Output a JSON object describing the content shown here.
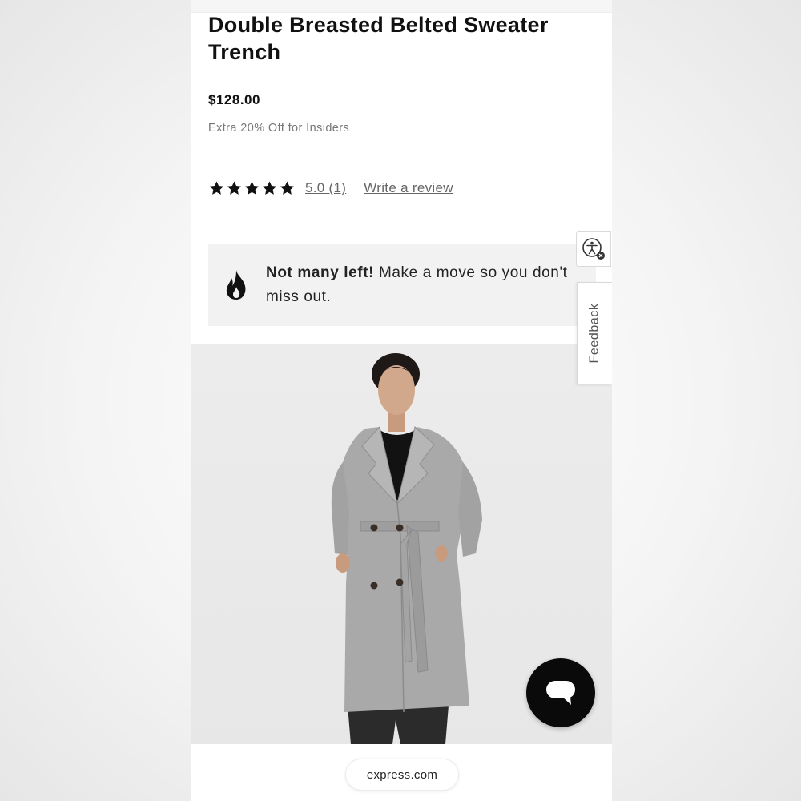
{
  "product": {
    "title": "Double Breasted Belted Sweater Trench",
    "price": "$128.00",
    "promo": "Extra 20% Off for Insiders"
  },
  "rating": {
    "stars": 5,
    "score_link": "5.0 (1)",
    "write_review": "Write a review"
  },
  "scarcity": {
    "icon": "fire-icon",
    "headline": "Not many left!",
    "body": " Make a move so you don't miss out."
  },
  "side_widgets": {
    "accessibility_icon": "accessibility-icon",
    "feedback_label": "Feedback"
  },
  "chat": {
    "icon": "chat-bubble-icon"
  },
  "browser": {
    "url": "express.com"
  },
  "colors": {
    "text": "#111111",
    "muted": "#777777",
    "banner_bg": "#f2f2f2",
    "chat_button": "#0a0a0a",
    "coat": "#a9a9a9"
  }
}
